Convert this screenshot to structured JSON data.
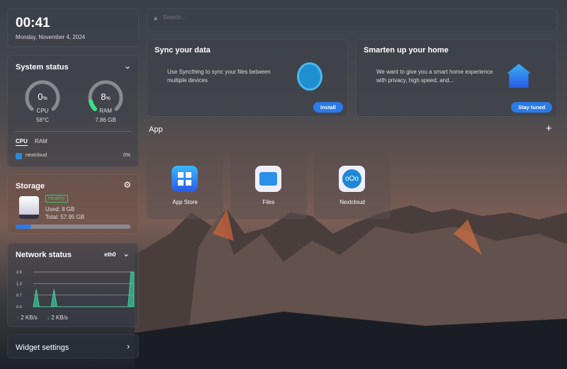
{
  "clock": {
    "time": "00:41",
    "date": "Monday, November 4, 2024"
  },
  "system": {
    "title": "System status",
    "cpu": {
      "value": "0",
      "unit": "%",
      "label": "CPU",
      "sub": "58°C",
      "percent": 0
    },
    "ram": {
      "value": "8",
      "unit": "%",
      "label": "RAM",
      "sub": "7.86 GB",
      "percent": 8
    },
    "tabs": [
      "CPU",
      "RAM"
    ],
    "process": {
      "name": "nextcloud",
      "value": "0%"
    }
  },
  "storage": {
    "title": "Storage",
    "badge": "Healthy",
    "used": "Used: 8 GB",
    "total": "Total: 57.95 GB",
    "percent": 13.8
  },
  "network": {
    "title": "Network status",
    "interface": "eth0",
    "yticks": [
      "2.0",
      "1.3",
      "0.7",
      "0.0"
    ],
    "series": [
      0,
      1.0,
      0,
      0,
      0,
      0,
      0,
      1.0,
      0,
      0,
      0,
      0,
      0,
      0,
      0,
      0,
      0,
      0,
      0,
      0,
      0,
      0,
      0,
      0,
      0,
      0,
      0,
      0,
      0,
      0,
      0,
      0,
      0,
      2.0,
      2.0
    ],
    "upload": "2 KB/s",
    "download": "2 KB/s"
  },
  "widget_settings": "Widget settings",
  "search": {
    "placeholder": "Search..."
  },
  "sync": {
    "title": "Sync your data",
    "desc": "Use Syncthing to sync your files between multiple devices",
    "button": "Install"
  },
  "home": {
    "title": "Smarten up your home",
    "desc": "We want to give you a smart home experience with privacy, high speed, and...",
    "button": "Stay tuned"
  },
  "apps": {
    "title": "App",
    "items": [
      {
        "label": "App Store"
      },
      {
        "label": "Files"
      },
      {
        "label": "Nextcloud"
      }
    ]
  },
  "colors": {
    "accent": "#2a7ae8",
    "healthy": "#3fc46a",
    "gauge": "#3de08a"
  }
}
